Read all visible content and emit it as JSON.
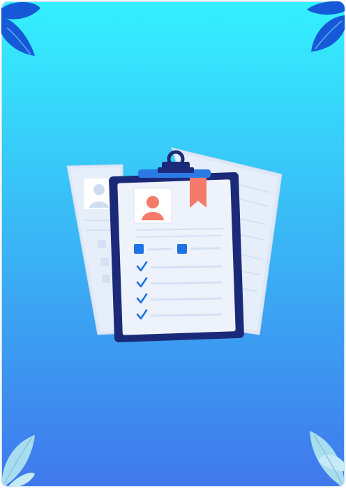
{
  "canvas": {
    "gradient_top": "#34F1FE",
    "gradient_bottom": "#4078EC",
    "border_color": "#CFE6F2"
  },
  "leaves": {
    "dark_color": "#1559D9",
    "light_color": "#A8DDF0",
    "top_left_icon": "leaf-cluster",
    "top_right_icon": "leaf-cluster",
    "bottom_left_icon": "leaf-cluster",
    "bottom_right_icon": "leaf-cluster"
  },
  "illustration": {
    "back_sheet_color": "#E6EEFA",
    "back_sheet_line_color": "#C9D8EE",
    "board_color": "#1B2A78",
    "paper_color": "#EEF2FB",
    "clip_color": "#1B2A78",
    "clip_bar_color": "#2C7BE5",
    "avatar_icon": "person-icon",
    "avatar_color": "#F47A6B",
    "bookmark_icon": "bookmark-icon",
    "bookmark_color": "#F47A6B",
    "checkbox_color": "#1E73E8",
    "checkmark_color": "#1E73E8",
    "line_color": "#D5E1F3",
    "checklist_count": 4
  }
}
